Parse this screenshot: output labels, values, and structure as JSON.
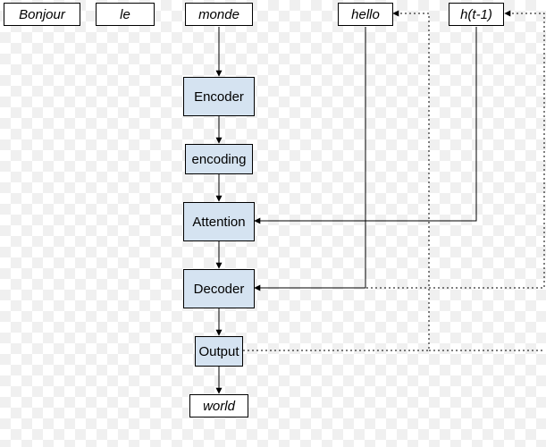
{
  "inputs": {
    "bonjour": "Bonjour",
    "le": "le",
    "monde": "monde",
    "hello": "hello",
    "hprev": "h(t-1)"
  },
  "blocks": {
    "encoder": "Encoder",
    "encoding": "encoding",
    "attention": "Attention",
    "decoder": "Decoder",
    "output": "Output"
  },
  "outputs": {
    "world": "world"
  }
}
